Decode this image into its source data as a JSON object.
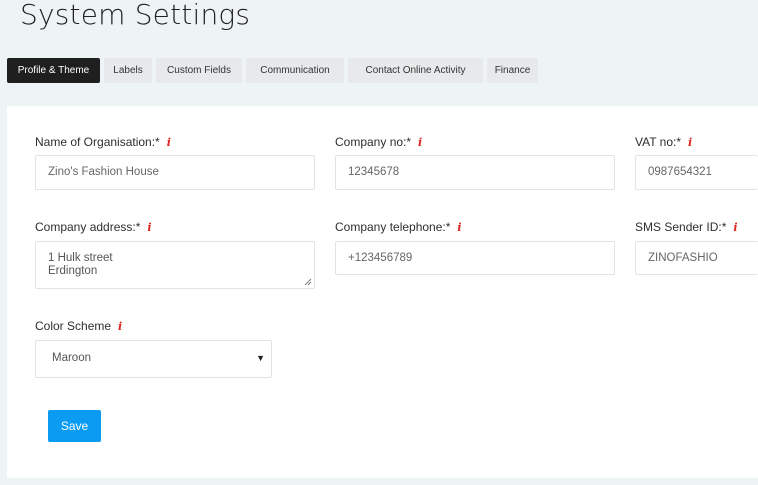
{
  "page": {
    "title": "System Settings"
  },
  "tabs": [
    {
      "label": "Profile & Theme",
      "active": true
    },
    {
      "label": "Labels",
      "active": false
    },
    {
      "label": "Custom Fields",
      "active": false
    },
    {
      "label": "Communication",
      "active": false
    },
    {
      "label": "Contact Online Activity",
      "active": false
    },
    {
      "label": "Finance",
      "active": false
    }
  ],
  "form": {
    "info_marker": "i",
    "organisation": {
      "label": "Name of Organisation:*",
      "value": "Zino's Fashion House"
    },
    "company_no": {
      "label": "Company no:*",
      "value": "12345678"
    },
    "vat_no": {
      "label": "VAT no:*",
      "value": "0987654321"
    },
    "company_address": {
      "label": "Company address:*",
      "value": "1 Hulk street\nErdington"
    },
    "company_telephone": {
      "label": "Company telephone:*",
      "value": "+123456789"
    },
    "sms_sender_id": {
      "label": "SMS Sender ID:*",
      "value": "ZINOFASHIO"
    },
    "color_scheme": {
      "label": "Color Scheme",
      "value": "Maroon"
    },
    "save_label": "Save"
  },
  "colors": {
    "accent": "#0b9bf2",
    "active_tab": "#1f1f1f",
    "info": "#e0261f",
    "background": "#eef3f6"
  },
  "icons": {
    "select_caret": "caret-down-icon",
    "info": "info-icon",
    "resize": "resize-handle-icon"
  }
}
